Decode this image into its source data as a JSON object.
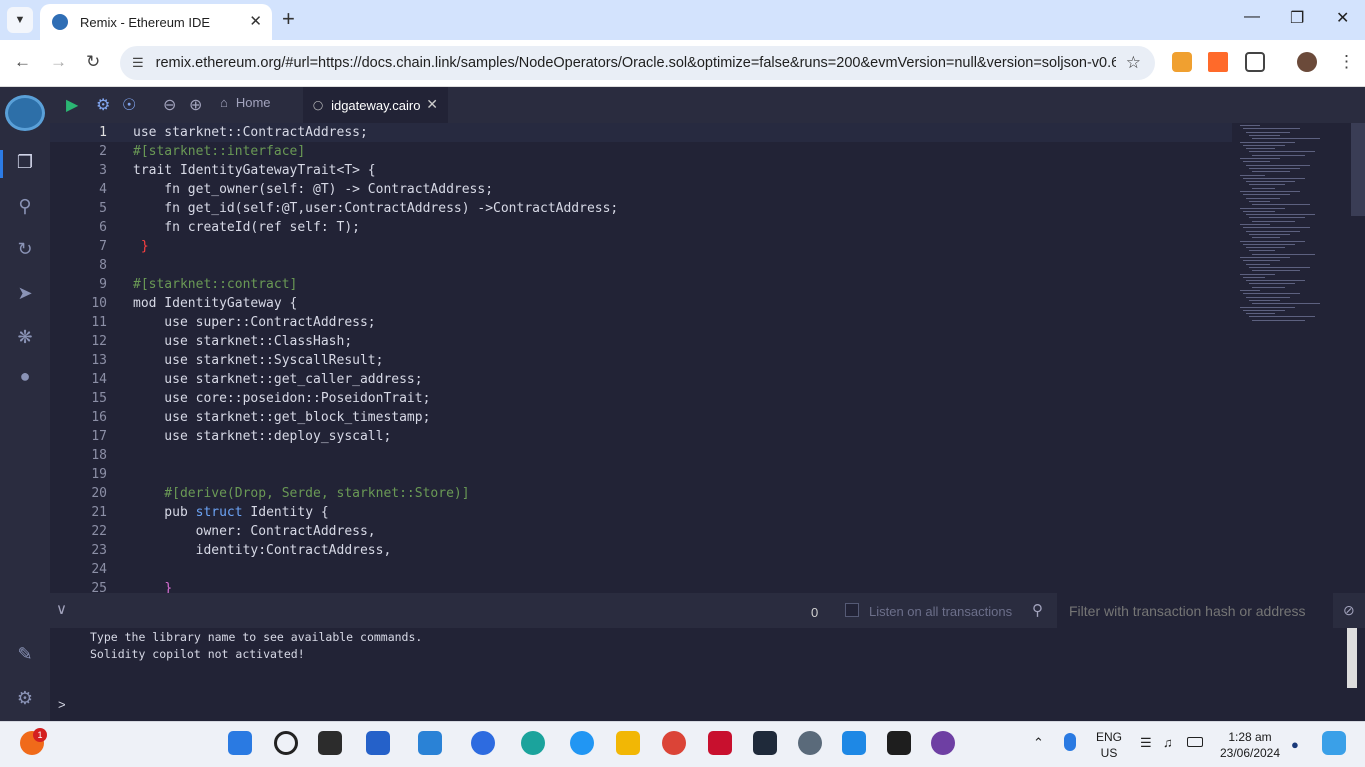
{
  "browser": {
    "tab_title": "Remix - Ethereum IDE",
    "url": "remix.ethereum.org/#url=https://docs.chain.link/samples/NodeOperators/Oracle.sol&optimize=false&runs=200&evmVersion=null&version=soljson-v0.6...."
  },
  "toolbar": {
    "home_label": "Home",
    "file_tab_label": "idgateway.cairo"
  },
  "editor": {
    "current_line": 1,
    "lines": [
      {
        "n": "1",
        "text": "use starknet::ContractAddress;"
      },
      {
        "n": "2",
        "text": "#[starknet::interface]"
      },
      {
        "n": "3",
        "text": "trait IdentityGatewayTrait<T> {"
      },
      {
        "n": "4",
        "text": "    fn get_owner(self: @T) -> ContractAddress;"
      },
      {
        "n": "5",
        "text": "    fn get_id(self:@T,user:ContractAddress) ->ContractAddress;"
      },
      {
        "n": "6",
        "text": "    fn createId(ref self: T);"
      },
      {
        "n": "7",
        "text": " }"
      },
      {
        "n": "8",
        "text": ""
      },
      {
        "n": "9",
        "text": "#[starknet::contract]"
      },
      {
        "n": "10",
        "text": "mod IdentityGateway {"
      },
      {
        "n": "11",
        "text": "    use super::ContractAddress;"
      },
      {
        "n": "12",
        "text": "    use starknet::ClassHash;"
      },
      {
        "n": "13",
        "text": "    use starknet::SyscallResult;"
      },
      {
        "n": "14",
        "text": "    use starknet::get_caller_address;"
      },
      {
        "n": "15",
        "text": "    use core::poseidon::PoseidonTrait;"
      },
      {
        "n": "16",
        "text": "    use starknet::get_block_timestamp;"
      },
      {
        "n": "17",
        "text": "    use starknet::deploy_syscall;"
      },
      {
        "n": "18",
        "text": ""
      },
      {
        "n": "19",
        "text": ""
      },
      {
        "n": "20",
        "text": "    #[derive(Drop, Serde, starknet::Store)]"
      },
      {
        "n": "21",
        "text": "    pub struct Identity {"
      },
      {
        "n": "22",
        "text": "        owner: ContractAddress,"
      },
      {
        "n": "23",
        "text": "        identity:ContractAddress,"
      },
      {
        "n": "24",
        "text": ""
      },
      {
        "n": "25",
        "text": "    }"
      }
    ]
  },
  "terminal": {
    "tx_count": "0",
    "listen_label": "Listen on all transactions",
    "filter_placeholder": "Filter with transaction hash or address",
    "lines": [
      "Type the library name to see available commands.",
      "Solidity copilot not activated!"
    ],
    "prompt": ">"
  },
  "taskbar": {
    "mail_badge": "1",
    "lang_line1": "ENG",
    "lang_line2": "US",
    "time": "1:28 am",
    "date": "23/06/2024"
  }
}
